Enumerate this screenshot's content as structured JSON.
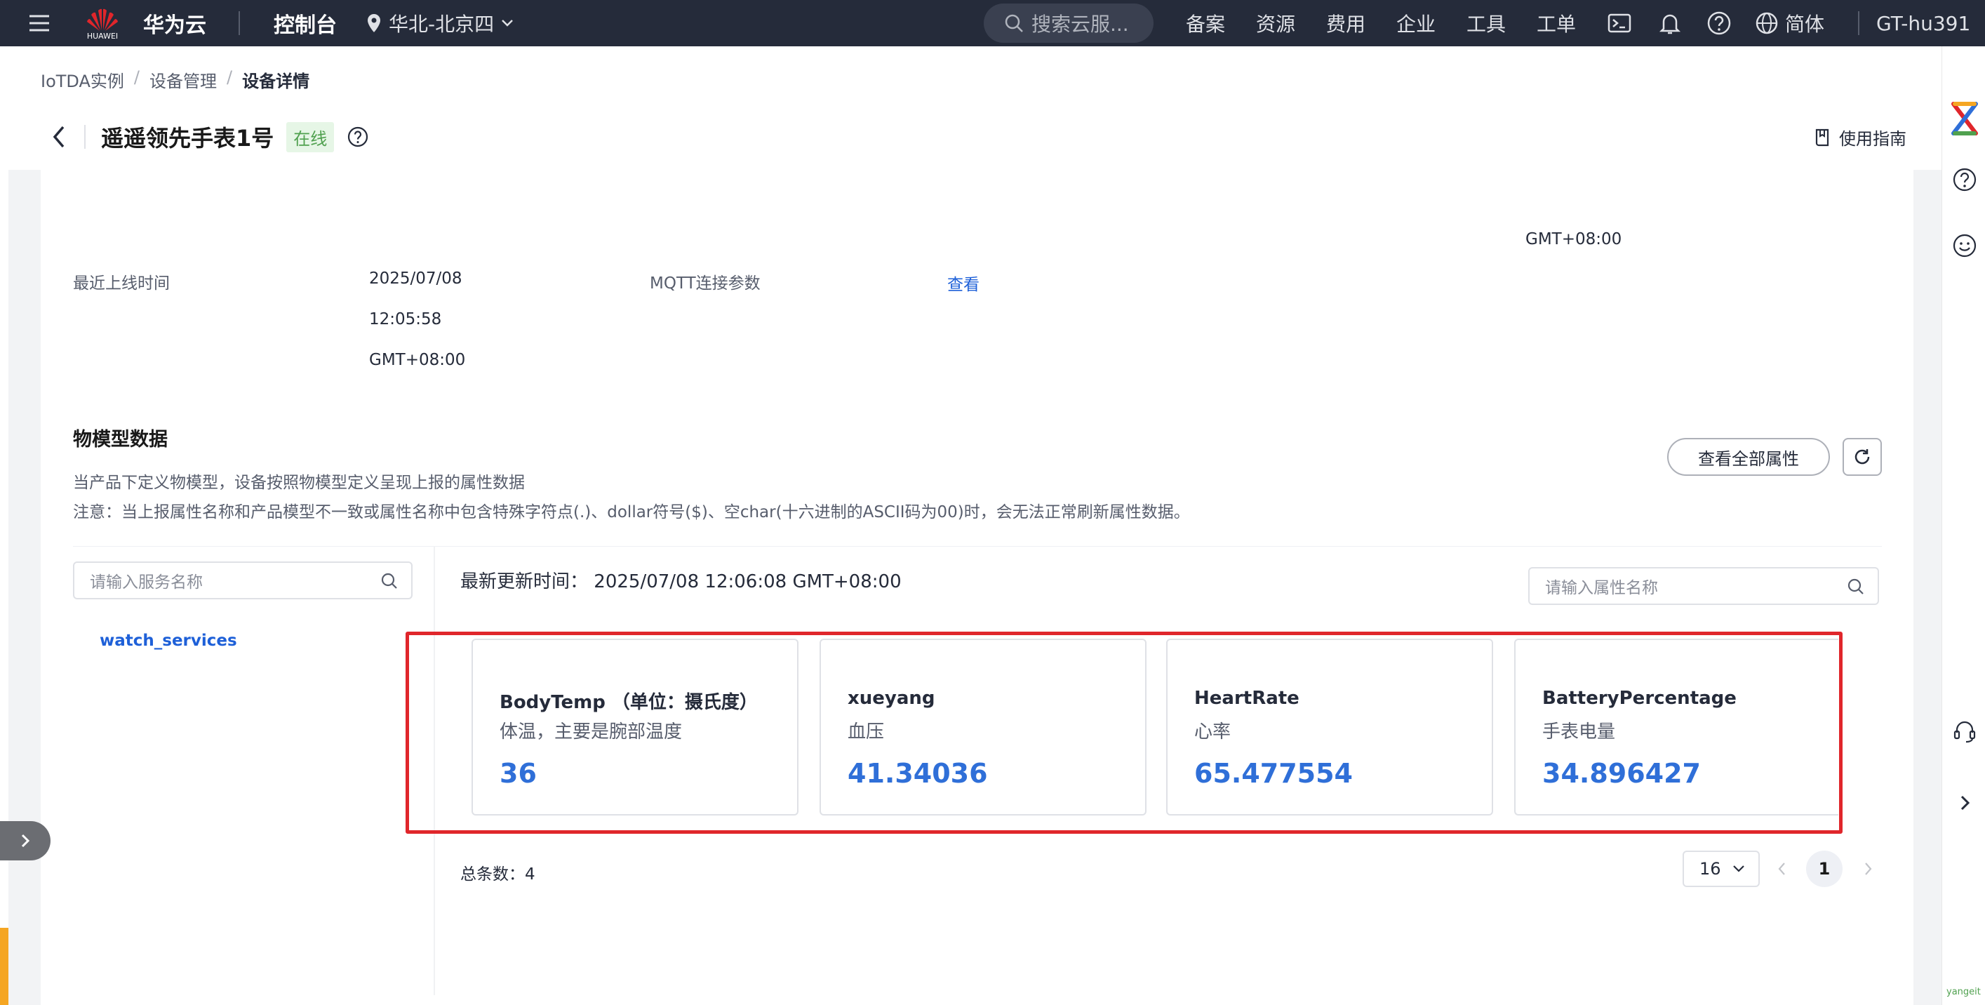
{
  "topbar": {
    "brand_small": "HUAWEI",
    "cloud_name": "华为云",
    "console": "控制台",
    "region": "华北-北京四",
    "search_placeholder": "搜索云服...",
    "nav": [
      "备案",
      "资源",
      "费用",
      "企业",
      "工具",
      "工单"
    ],
    "language": "简体",
    "user": "GT-hu391"
  },
  "breadcrumb": [
    "IoTDA实例",
    "设备管理",
    "设备详情"
  ],
  "page": {
    "title": "遥遥领先手表1号",
    "status": "在线",
    "guide": "使用指南"
  },
  "basic_info": {
    "top_right_tz": "GMT+08:00",
    "last_online_label": "最近上线时间",
    "last_online_date": "2025/07/08",
    "last_online_time": "12:05:58",
    "last_online_tz": "GMT+08:00",
    "mqtt_label": "MQTT连接参数",
    "mqtt_link": "查看"
  },
  "model": {
    "title": "物模型数据",
    "desc1": "当产品下定义物模型，设备按照物模型定义呈现上报的属性数据",
    "desc2": "注意：当上报属性名称和产品模型不一致或属性名称中包含特殊字符点(.)、dollar符号($)、空char(十六进制的ASCII码为00)时，会无法正常刷新属性数据。",
    "view_all": "查看全部属性",
    "service_search_placeholder": "请输入服务名称",
    "property_search_placeholder": "请输入属性名称",
    "service": "watch_services",
    "updated_label": "最新更新时间：",
    "updated_value": "2025/07/08 12:06:08 GMT+08:00",
    "properties": [
      {
        "name": "BodyTemp （单位：摄氏度）",
        "desc": "体温，主要是腕部温度",
        "value": "36"
      },
      {
        "name": "xueyang",
        "desc": "血压",
        "value": "41.34036"
      },
      {
        "name": "HeartRate",
        "desc": "心率",
        "value": "65.477554"
      },
      {
        "name": "BatteryPercentage",
        "desc": "手表电量",
        "value": "34.896427"
      }
    ],
    "total": "总条数：4",
    "page_size": "16",
    "current_page": "1"
  },
  "watermark": "yangeit",
  "colors": {
    "topbar": "#252b3a",
    "link": "#1e60d8",
    "highlight": "#e0262b",
    "value": "#2f6fd8"
  }
}
